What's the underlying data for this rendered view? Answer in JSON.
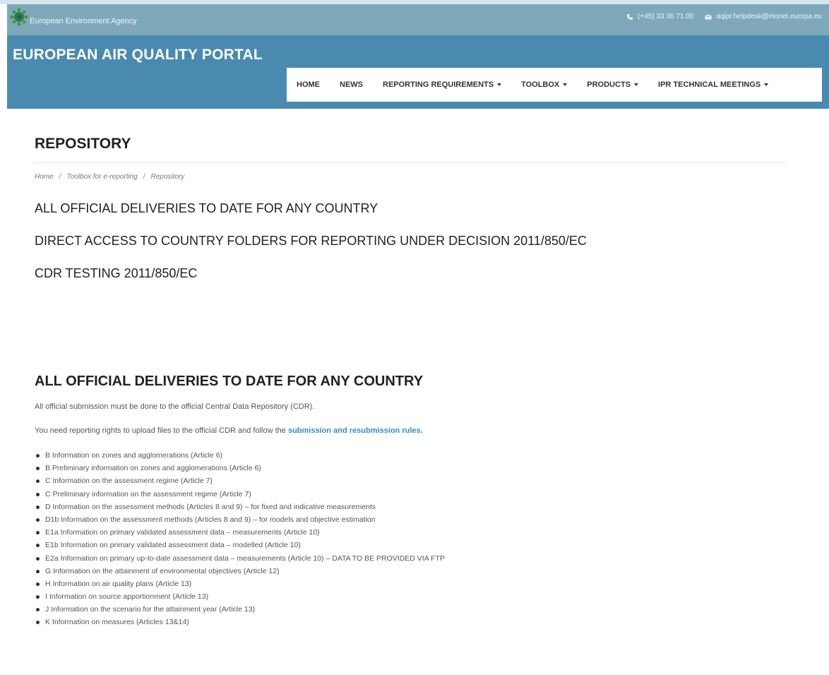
{
  "topbar": {
    "agency_name": "European Environment Agency",
    "phone": "(+45) 33 36 71 00",
    "email": "aqipr.helpdesk@eionet.europa.eu"
  },
  "header": {
    "portal_title": "EUROPEAN AIR QUALITY PORTAL",
    "nav": [
      {
        "label": "HOME"
      },
      {
        "label": "NEWS"
      },
      {
        "label": "REPORTING REQUIREMENTS"
      },
      {
        "label": "TOOLBOX"
      },
      {
        "label": "PRODUCTS"
      },
      {
        "label": "IPR TECHNICAL MEETINGS"
      }
    ]
  },
  "page": {
    "title": "REPOSITORY",
    "breadcrumb": [
      "Home",
      "Toolbox for e-reporting",
      "Repository"
    ],
    "breadcrumb_sep": "/",
    "quick_links": [
      "ALL OFFICIAL DELIVERIES TO DATE FOR ANY COUNTRY",
      "DIRECT ACCESS TO COUNTRY FOLDERS FOR REPORTING UNDER DECISION 2011/850/EC",
      "CDR TESTING 2011/850/EC"
    ],
    "section_title": "ALL OFFICIAL DELIVERIES TO DATE FOR ANY COUNTRY",
    "para1": "All official submission must be done to the official Central Data Repository (CDR).",
    "para2_text": "You need reporting rights to upload files to the official CDR and follow the",
    "para2_link": "submission and resubmission rules.",
    "deliveries": [
      "B Information on zones and agglomerations (Article 6)",
      "B Preliminary information on zones and agglomerations (Article 6)",
      "C Information on the assessment regime (Article 7)",
      "C Preliminary information on the assessment regime (Article 7)",
      "D Information on the assessment methods (Articles 8 and 9) – for fixed and indicative measurements",
      "D1b Information on the assessment methods (Articles 8 and 9) – for models and objective estimation",
      "E1a Information on primary validated assessment data – measurements (Article 10)",
      "E1b Information on primary validated assessment data – modelled (Article 10)",
      "E2a Information on primary up-to-date assessment data – measurements (Article 10) – DATA TO BE PROVIDED VIA FTP",
      "G Information on the attainment of environmental objectives (Article 12)",
      "H Information on air quality plans (Article 13)",
      "I Information on source apportionment (Article 13)",
      "J Information on the scenario for the attainment year (Article 13)",
      "K Information on measures (Articles 13&14)"
    ]
  }
}
